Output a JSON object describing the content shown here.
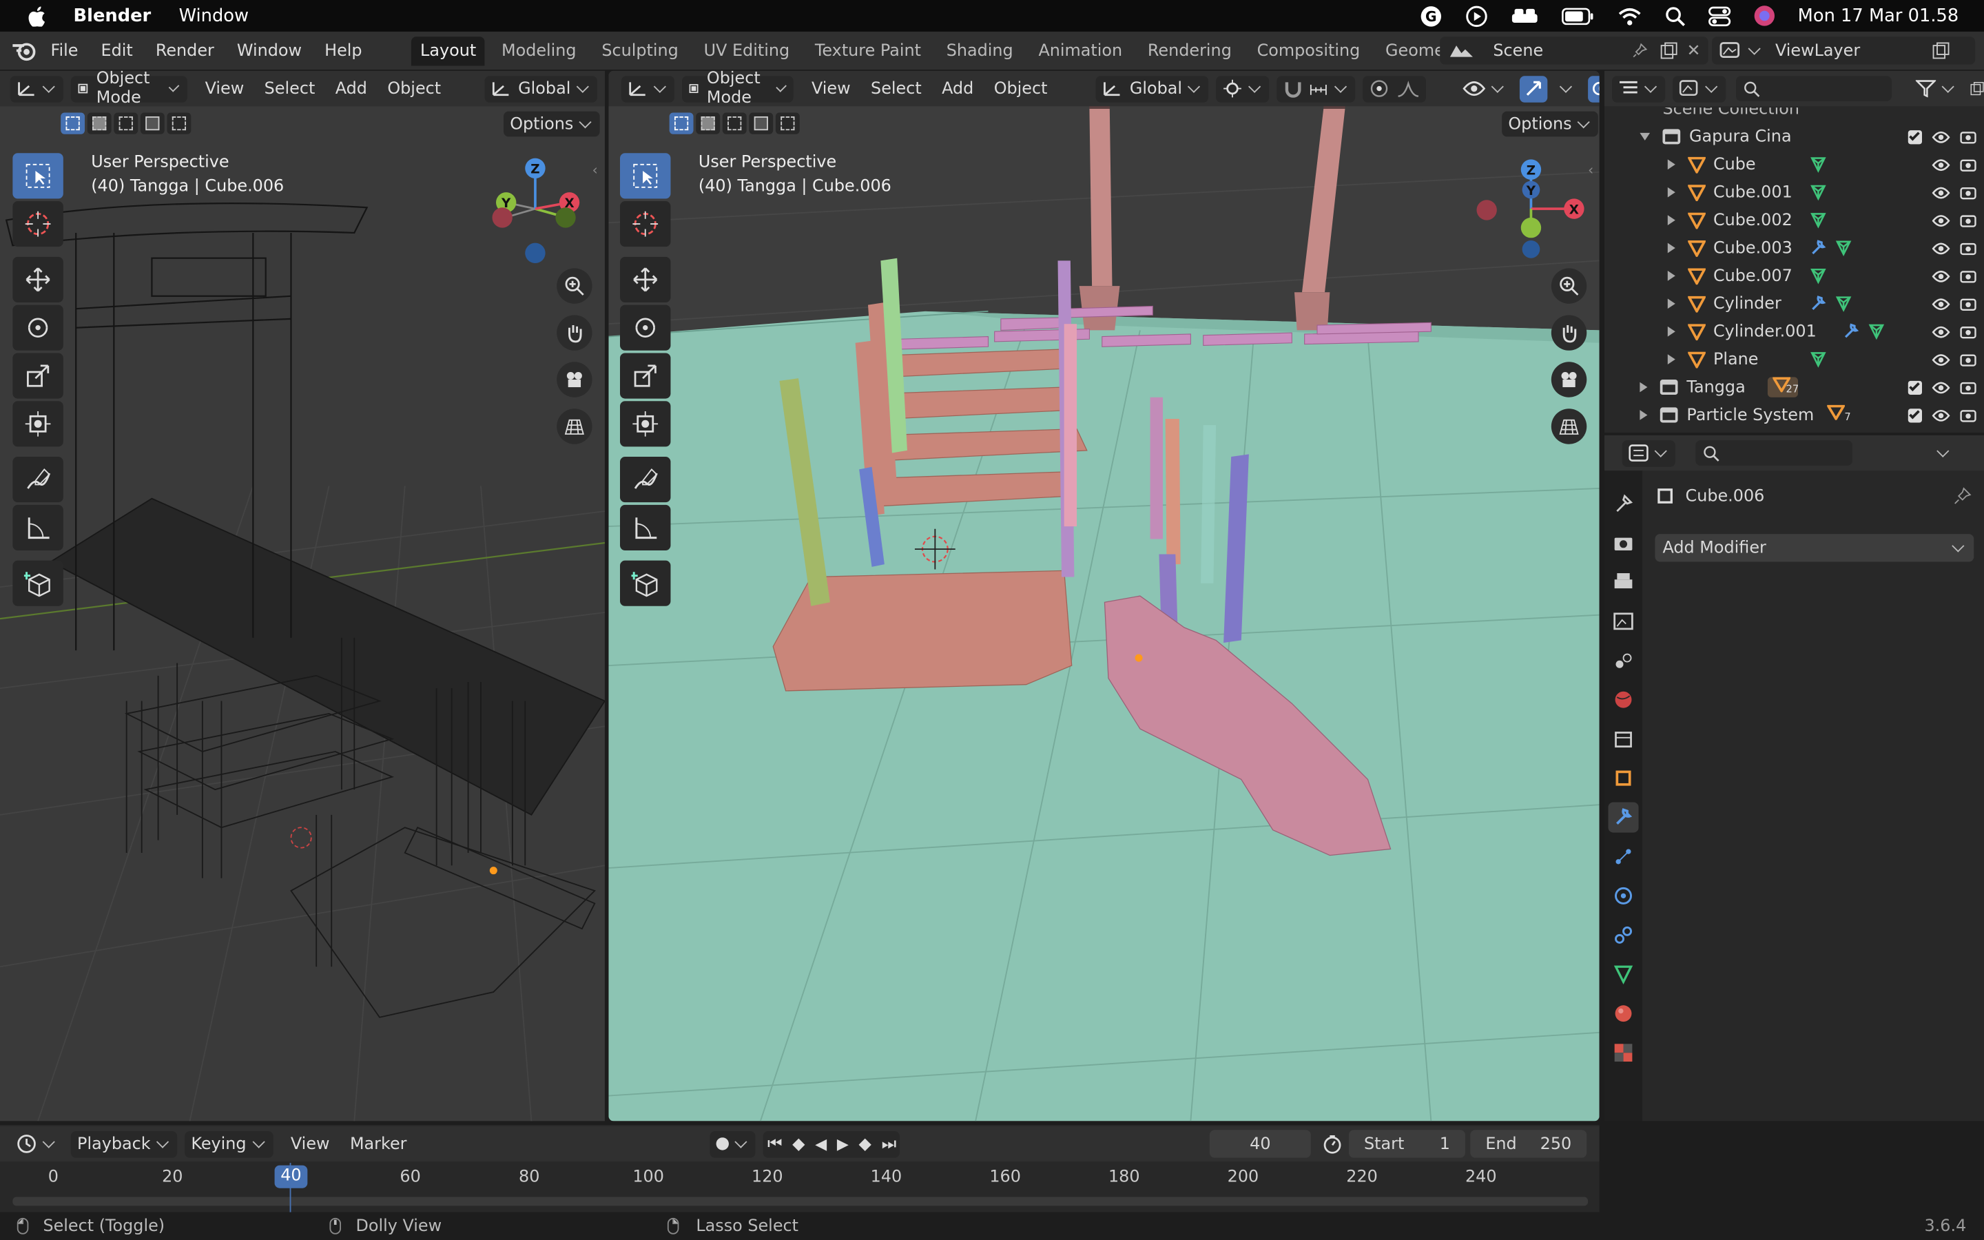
{
  "macbar": {
    "app": "Blender",
    "window_menu": "Window",
    "datetime": "Mon 17 Mar  01.58"
  },
  "menu": [
    "File",
    "Edit",
    "Render",
    "Window",
    "Help"
  ],
  "workspaces": [
    "Layout",
    "Modeling",
    "Sculpting",
    "UV Editing",
    "Texture Paint",
    "Shading",
    "Animation",
    "Rendering",
    "Compositing",
    "Geometry Nodes"
  ],
  "scene": "Scene",
  "viewlayer": "ViewLayer",
  "viewport_left": {
    "mode": "Object Mode",
    "menus": [
      "View",
      "Select",
      "Add",
      "Object"
    ],
    "orientation": "Global",
    "options": "Options",
    "overlay_title": "User Perspective",
    "overlay_sub": "(40) Tangga | Cube.006"
  },
  "viewport_right": {
    "mode": "Object Mode",
    "menus": [
      "View",
      "Select",
      "Add",
      "Object"
    ],
    "orientation": "Global",
    "options": "Options",
    "overlay_title": "User Perspective",
    "overlay_sub": "(40) Tangga | Cube.006"
  },
  "gizmo": {
    "x": "X",
    "y": "Y",
    "z": "Z"
  },
  "outliner": {
    "root": "Scene Collection",
    "collection": "Gapura Cina",
    "items": [
      "Cube",
      "Cube.001",
      "Cube.002",
      "Cube.003",
      "Cube.007",
      "Cylinder",
      "Cylinder.001",
      "Plane"
    ],
    "tangga": "Tangga",
    "tangga_count": "27",
    "particle": "Particle System",
    "particle_count": "7"
  },
  "properties": {
    "object": "Cube.006",
    "add_modifier": "Add Modifier"
  },
  "timeline": {
    "menus": [
      "Playback",
      "Keying",
      "View",
      "Marker"
    ],
    "frame": "40",
    "start_label": "Start",
    "start": "1",
    "end_label": "End",
    "end": "250",
    "ticks": [
      "0",
      "20",
      "40",
      "60",
      "80",
      "100",
      "120",
      "140",
      "160",
      "180",
      "200",
      "220",
      "240"
    ],
    "current": "40"
  },
  "status": {
    "select": "Select (Toggle)",
    "dolly": "Dolly View",
    "lasso": "Lasso Select",
    "version": "3.6.4"
  },
  "colors": {
    "accent": "#4772b3",
    "floor": "#8cc4b3",
    "mesh_pink": "#c9867a",
    "active_tab": "#1d1d1d"
  }
}
